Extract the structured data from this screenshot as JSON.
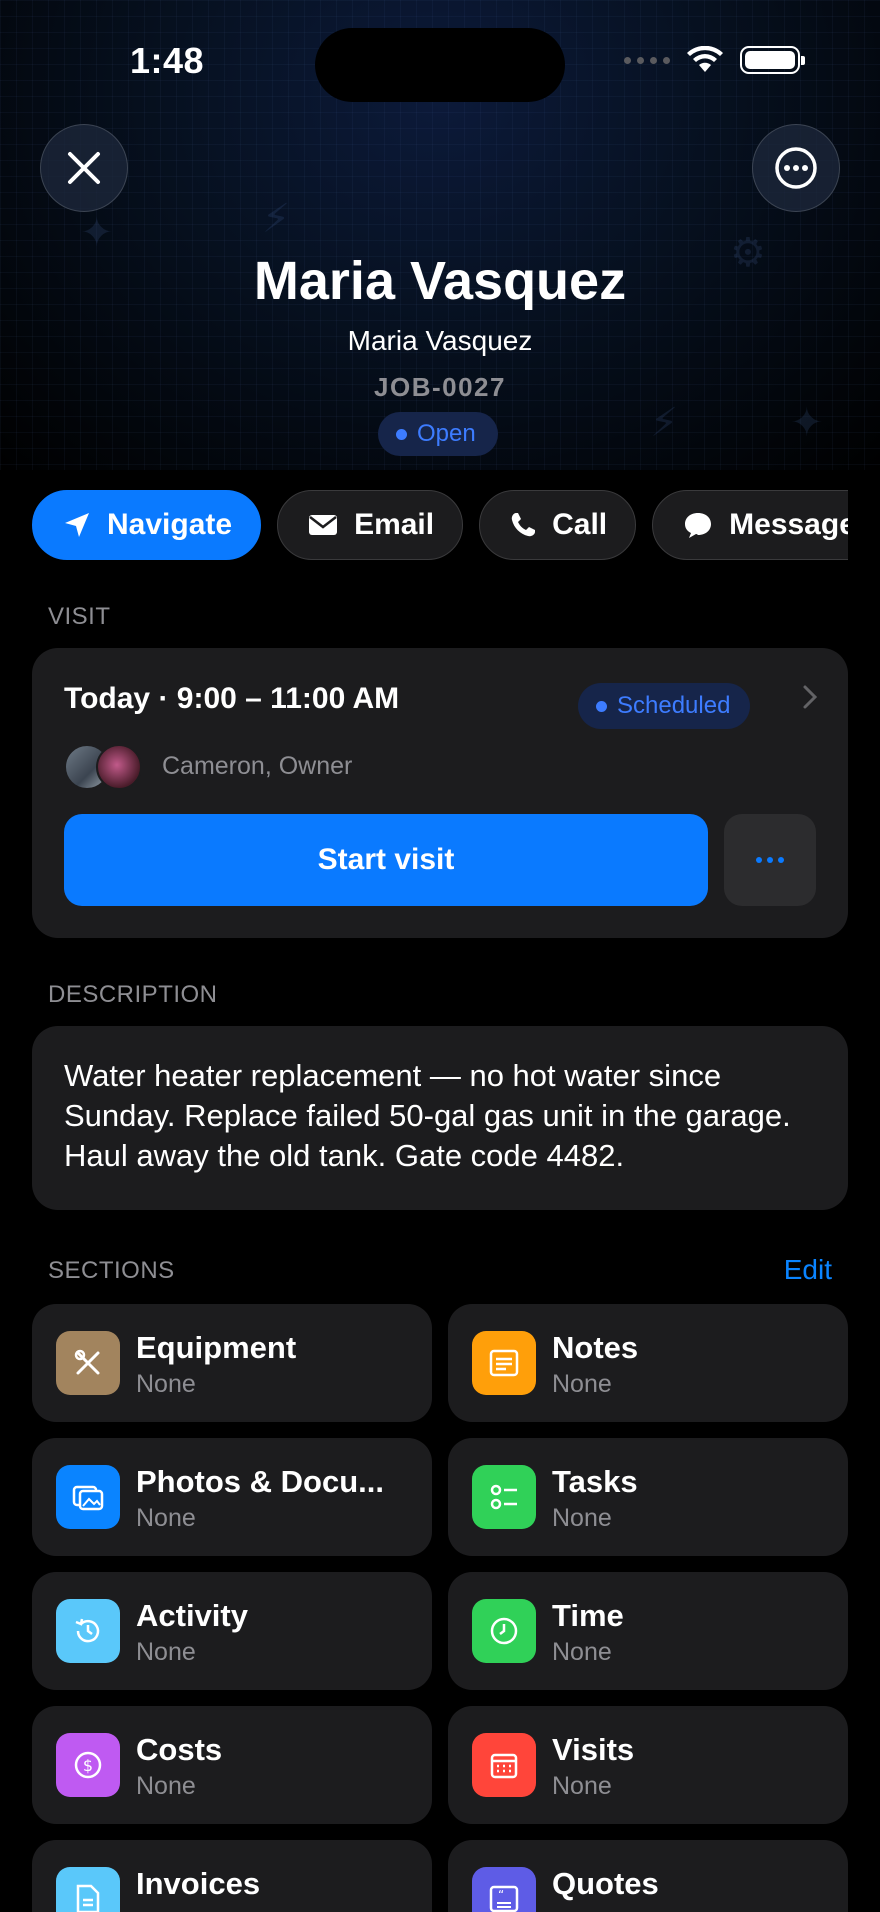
{
  "status_bar": {
    "time": "1:48"
  },
  "header": {
    "title": "Maria Vasquez",
    "subtitle": "Maria Vasquez",
    "job_id": "JOB-0027",
    "status": "Open",
    "status_color": "#3d7cff"
  },
  "actions": [
    {
      "label": "Navigate",
      "icon": "navigate-arrow-icon"
    },
    {
      "label": "Email",
      "icon": "envelope-icon"
    },
    {
      "label": "Call",
      "icon": "phone-icon"
    },
    {
      "label": "Message",
      "icon": "chat-bubble-icon"
    }
  ],
  "visit": {
    "section_label": "VISIT",
    "when": "Today · 9:00 – 11:00 AM",
    "status": "Scheduled",
    "assignees": "Cameron, Owner",
    "start_label": "Start visit"
  },
  "description": {
    "section_label": "DESCRIPTION",
    "text": "Water heater replacement — no hot water since Sunday. Replace failed 50-gal gas unit in the garage. Haul away the old tank. Gate code 4482."
  },
  "sections": {
    "label": "SECTIONS",
    "edit_label": "Edit",
    "items": [
      {
        "name": "Equipment",
        "sub": "None",
        "icon": "tools-icon",
        "color": "#a2845e"
      },
      {
        "name": "Notes",
        "sub": "None",
        "icon": "note-icon",
        "color": "#ff9f0a"
      },
      {
        "name": "Photos & Docu...",
        "sub": "None",
        "icon": "photos-icon",
        "color": "#0a84ff"
      },
      {
        "name": "Tasks",
        "sub": "None",
        "icon": "checklist-icon",
        "color": "#30d158"
      },
      {
        "name": "Activity",
        "sub": "None",
        "icon": "history-icon",
        "color": "#5ac8fa"
      },
      {
        "name": "Time",
        "sub": "None",
        "icon": "clock-icon",
        "color": "#30d158"
      },
      {
        "name": "Costs",
        "sub": "None",
        "icon": "dollar-icon",
        "color": "#bf5af2"
      },
      {
        "name": "Visits",
        "sub": "None",
        "icon": "calendar-icon",
        "color": "#ff453a"
      },
      {
        "name": "Invoices",
        "sub": "",
        "icon": "invoice-icon",
        "color": "#5ac8fa"
      },
      {
        "name": "Quotes",
        "sub": "",
        "icon": "quote-icon",
        "color": "#5e5ce6"
      }
    ]
  }
}
